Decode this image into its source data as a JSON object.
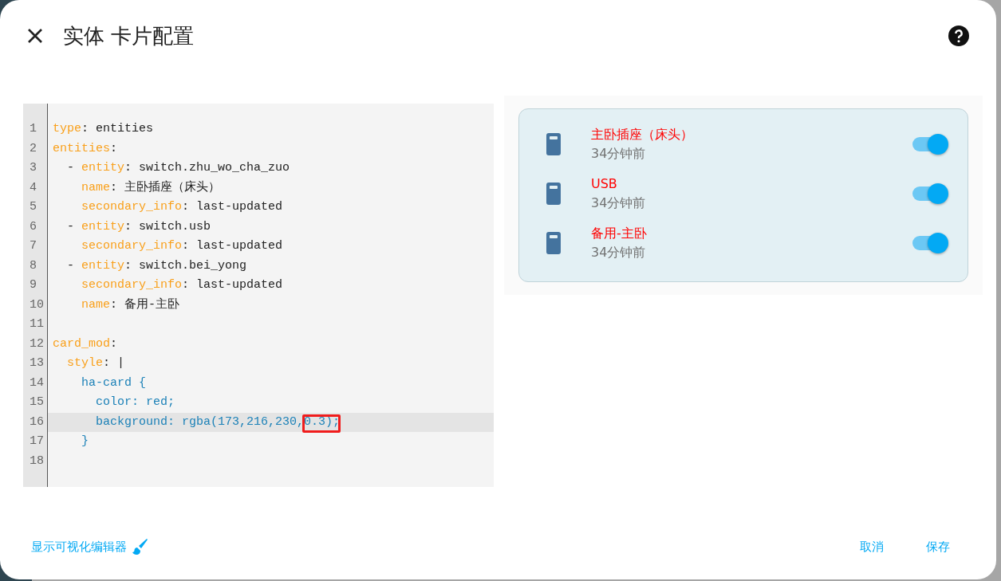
{
  "dialog": {
    "title": "实体 卡片配置"
  },
  "editor": {
    "lines": [
      {
        "number": "1",
        "active": false,
        "tokens": [
          {
            "kind": "key",
            "text": "type"
          },
          {
            "kind": "plain",
            "text": ": entities"
          }
        ]
      },
      {
        "number": "2",
        "active": false,
        "tokens": [
          {
            "kind": "key",
            "text": "entities"
          },
          {
            "kind": "plain",
            "text": ":"
          }
        ]
      },
      {
        "number": "3",
        "active": false,
        "tokens": [
          {
            "kind": "plain",
            "text": "  - "
          },
          {
            "kind": "key",
            "text": "entity"
          },
          {
            "kind": "plain",
            "text": ": switch.zhu_wo_cha_zuo"
          }
        ]
      },
      {
        "number": "4",
        "active": false,
        "tokens": [
          {
            "kind": "key",
            "text": "    name"
          },
          {
            "kind": "plain",
            "text": ": 主卧插座（床头）"
          }
        ]
      },
      {
        "number": "5",
        "active": false,
        "tokens": [
          {
            "kind": "key",
            "text": "    secondary_info"
          },
          {
            "kind": "plain",
            "text": ": last-updated"
          }
        ]
      },
      {
        "number": "6",
        "active": false,
        "tokens": [
          {
            "kind": "plain",
            "text": "  - "
          },
          {
            "kind": "key",
            "text": "entity"
          },
          {
            "kind": "plain",
            "text": ": switch.usb"
          }
        ]
      },
      {
        "number": "7",
        "active": false,
        "tokens": [
          {
            "kind": "key",
            "text": "    secondary_info"
          },
          {
            "kind": "plain",
            "text": ": last-updated"
          }
        ]
      },
      {
        "number": "8",
        "active": false,
        "tokens": [
          {
            "kind": "plain",
            "text": "  - "
          },
          {
            "kind": "key",
            "text": "entity"
          },
          {
            "kind": "plain",
            "text": ": switch.bei_yong"
          }
        ]
      },
      {
        "number": "9",
        "active": false,
        "tokens": [
          {
            "kind": "key",
            "text": "    secondary_info"
          },
          {
            "kind": "plain",
            "text": ": last-updated"
          }
        ]
      },
      {
        "number": "10",
        "active": false,
        "tokens": [
          {
            "kind": "key",
            "text": "    name"
          },
          {
            "kind": "plain",
            "text": ": 备用-主卧"
          }
        ]
      },
      {
        "number": "11",
        "active": false
      },
      {
        "number": "12",
        "active": false,
        "tokens": [
          {
            "kind": "key",
            "text": "card_mod"
          },
          {
            "kind": "plain",
            "text": ":"
          }
        ]
      },
      {
        "number": "13",
        "active": false,
        "tokens": [
          {
            "kind": "key",
            "text": "  style"
          },
          {
            "kind": "plain",
            "text": ": |"
          }
        ]
      },
      {
        "number": "14",
        "active": false,
        "tokens": [
          {
            "kind": "css",
            "text": "    ha-card {"
          }
        ]
      },
      {
        "number": "15",
        "active": false,
        "tokens": [
          {
            "kind": "css",
            "text": "      color: red;"
          }
        ]
      },
      {
        "number": "16",
        "active": true,
        "tokens": [
          {
            "kind": "css",
            "text": "      background: rgba(173,216,230,"
          },
          {
            "kind": "boxed",
            "text": "0.3)"
          },
          {
            "kind": "css",
            "text": ";"
          }
        ]
      },
      {
        "number": "17",
        "active": false,
        "tokens": [
          {
            "kind": "css",
            "text": "    }"
          }
        ]
      },
      {
        "number": "18",
        "active": false
      }
    ]
  },
  "preview": {
    "rows": [
      {
        "name": "主卧插座（床头）",
        "secondary": "34分钟前",
        "on": true
      },
      {
        "name": "USB",
        "secondary": "34分钟前",
        "on": true
      },
      {
        "name": "备用-主卧",
        "secondary": "34分钟前",
        "on": true
      }
    ]
  },
  "footer": {
    "link": "显示可视化编辑器",
    "buttons": [
      "取消",
      "保存"
    ]
  }
}
